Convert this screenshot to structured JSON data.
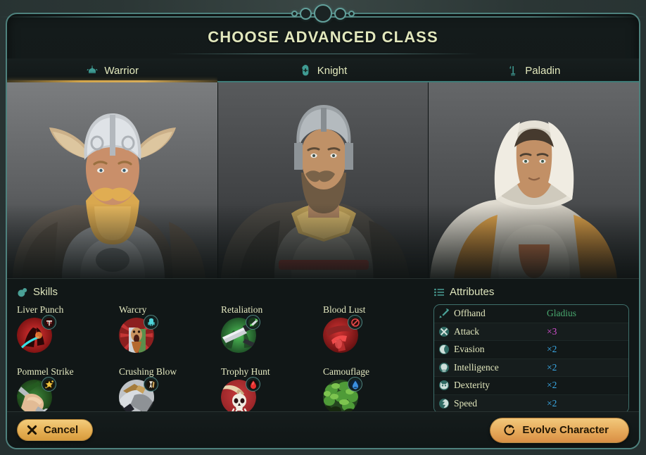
{
  "dialog": {
    "title": "CHOOSE ADVANCED CLASS"
  },
  "tabs": [
    {
      "label": "Warrior",
      "icon": "warrior-helm-icon",
      "active": true
    },
    {
      "label": "Knight",
      "icon": "knight-helm-icon",
      "active": false
    },
    {
      "label": "Paladin",
      "icon": "paladin-banner-icon",
      "active": false
    }
  ],
  "portraits": [
    {
      "name": "warrior-portrait",
      "alt": "Horned-helmet warrior with blond beard"
    },
    {
      "name": "knight-portrait",
      "alt": "Bearded knight in plate armor"
    },
    {
      "name": "paladin-portrait",
      "alt": "Hooded paladin in white and gold robes"
    }
  ],
  "skills": {
    "heading": "Skills",
    "heading_icon": "skills-icon",
    "items": [
      {
        "name": "Liver Punch",
        "icon": "liver-punch-icon",
        "badge": "poison-badge-icon"
      },
      {
        "name": "Warcry",
        "icon": "warcry-icon",
        "badge": "shout-badge-icon"
      },
      {
        "name": "Retaliation",
        "icon": "retaliation-icon",
        "badge": "counter-badge-icon"
      },
      {
        "name": "Blood Lust",
        "icon": "blood-lust-icon",
        "badge": "bleed-badge-icon"
      },
      {
        "name": "Pommel Strike",
        "icon": "pommel-strike-icon",
        "badge": "stun-badge-icon"
      },
      {
        "name": "Crushing Blow",
        "icon": "crushing-blow-icon",
        "badge": "crush-badge-icon"
      },
      {
        "name": "Trophy Hunt",
        "icon": "trophy-hunt-icon",
        "badge": "blood-drop-badge-icon"
      },
      {
        "name": "Camouflage",
        "icon": "camouflage-icon",
        "badge": "stealth-badge-icon"
      }
    ]
  },
  "attributes": {
    "heading": "Attributes",
    "heading_icon": "attributes-list-icon",
    "rows": [
      {
        "label": "Offhand",
        "value": "Gladius",
        "icon": "offhand-icon",
        "value_color": "#49a86f"
      },
      {
        "label": "Attack",
        "value": "×3",
        "icon": "attack-icon",
        "value_color": "#d44fd0"
      },
      {
        "label": "Evasion",
        "value": "×2",
        "icon": "evasion-icon",
        "value_color": "#3aa9e6"
      },
      {
        "label": "Intelligence",
        "value": "×2",
        "icon": "intelligence-icon",
        "value_color": "#3aa9e6"
      },
      {
        "label": "Dexterity",
        "value": "×2",
        "icon": "dexterity-icon",
        "value_color": "#3aa9e6"
      },
      {
        "label": "Speed",
        "value": "×2",
        "icon": "speed-icon",
        "value_color": "#3aa9e6"
      }
    ]
  },
  "footer": {
    "cancel_label": "Cancel",
    "cancel_icon": "close-x-icon",
    "evolve_label": "Evolve Character",
    "evolve_icon": "refresh-circular-icon"
  },
  "colors": {
    "frame_border": "#4e817d",
    "title_text": "#e2e8bd",
    "accent_gold": "#d8ad58",
    "accent_teal": "#4fa39c",
    "panel_bg": "#121818"
  }
}
